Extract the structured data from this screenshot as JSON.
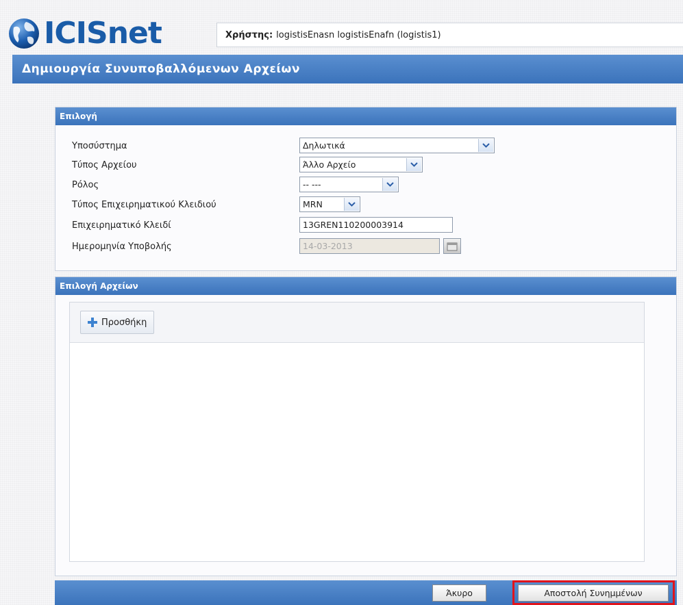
{
  "app": {
    "logo_text": "ICISnet"
  },
  "user": {
    "label": "Χρήστης:",
    "value": "logistisEnasn logistisEnafn (logistis1)"
  },
  "page_title": "Δημιουργία Συνυποβαλλόμενων Αρχείων",
  "selection_panel": {
    "title": "Επιλογή",
    "fields": [
      {
        "label": "Υποσύστημα",
        "value": "Δηλωτικά"
      },
      {
        "label": "Τύπος Αρχείου",
        "value": "Άλλο Αρχείο"
      },
      {
        "label": "Ρόλος",
        "value": "-- ---"
      },
      {
        "label": "Τύπος Επιχειρηματικού Κλειδιού",
        "value": "MRN"
      },
      {
        "label": "Επιχειρηματικό Κλειδί",
        "value": "13GREN110200003914"
      },
      {
        "label": "Ημερομηνία Υποβολής",
        "value": "14-03-2013"
      }
    ]
  },
  "files_panel": {
    "title": "Επιλογή Αρχείων",
    "add_label": "Προσθήκη"
  },
  "footer": {
    "cancel_label": "Άκυρο",
    "submit_label": "Αποστολή Συνημμένων"
  },
  "colors": {
    "header_blue": "#3b73bb",
    "highlight_red": "#e0141c",
    "logo_blue": "#1a5ca8"
  },
  "icons": {
    "logo": "globe-icon",
    "dropdown": "chevron-down-icon",
    "calendar": "calendar-icon",
    "add": "plus-icon"
  }
}
